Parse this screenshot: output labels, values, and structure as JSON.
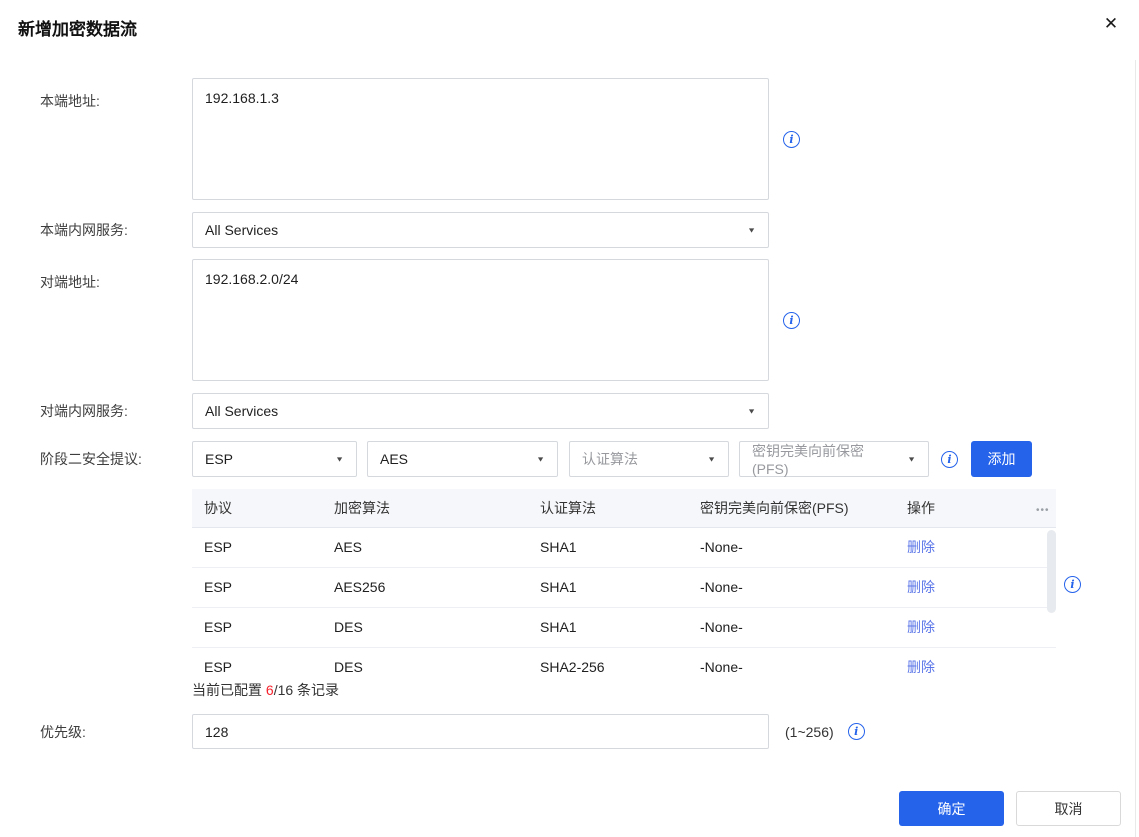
{
  "dialog": {
    "title": "新增加密数据流"
  },
  "icons": {
    "close": "✕",
    "caret": "▼",
    "info": "i",
    "more": "•••"
  },
  "form": {
    "local_address": {
      "label": "本端地址:",
      "value": "192.168.1.3"
    },
    "local_service": {
      "label": "本端内网服务:",
      "value": "All Services"
    },
    "peer_address": {
      "label": "对端地址:",
      "value": "192.168.2.0/24"
    },
    "peer_service": {
      "label": "对端内网服务:",
      "value": "All Services"
    },
    "proposal": {
      "label": "阶段二安全提议:",
      "protocol_value": "ESP",
      "encryption_value": "AES",
      "auth_placeholder": "认证算法",
      "pfs_placeholder": "密钥完美向前保密(PFS)",
      "add_button": "添加"
    },
    "priority": {
      "label": "优先级:",
      "value": "128",
      "hint": "(1~256)"
    }
  },
  "table": {
    "headers": {
      "protocol": "协议",
      "encryption": "加密算法",
      "auth": "认证算法",
      "pfs": "密钥完美向前保密(PFS)",
      "action": "操作"
    },
    "rows": [
      {
        "protocol": "ESP",
        "encryption": "AES",
        "auth": "SHA1",
        "pfs": "-None-",
        "action": "删除"
      },
      {
        "protocol": "ESP",
        "encryption": "AES256",
        "auth": "SHA1",
        "pfs": "-None-",
        "action": "删除"
      },
      {
        "protocol": "ESP",
        "encryption": "DES",
        "auth": "SHA1",
        "pfs": "-None-",
        "action": "删除"
      },
      {
        "protocol": "ESP",
        "encryption": "DES",
        "auth": "SHA2-256",
        "pfs": "-None-",
        "action": "删除"
      }
    ],
    "count": {
      "prefix": "当前已配置 ",
      "current": "6",
      "suffix": "/16 条记录"
    }
  },
  "footer": {
    "ok": "确定",
    "cancel": "取消"
  },
  "colors": {
    "accent": "#2563eb",
    "link": "#5b76e8",
    "danger": "#f5222d"
  }
}
